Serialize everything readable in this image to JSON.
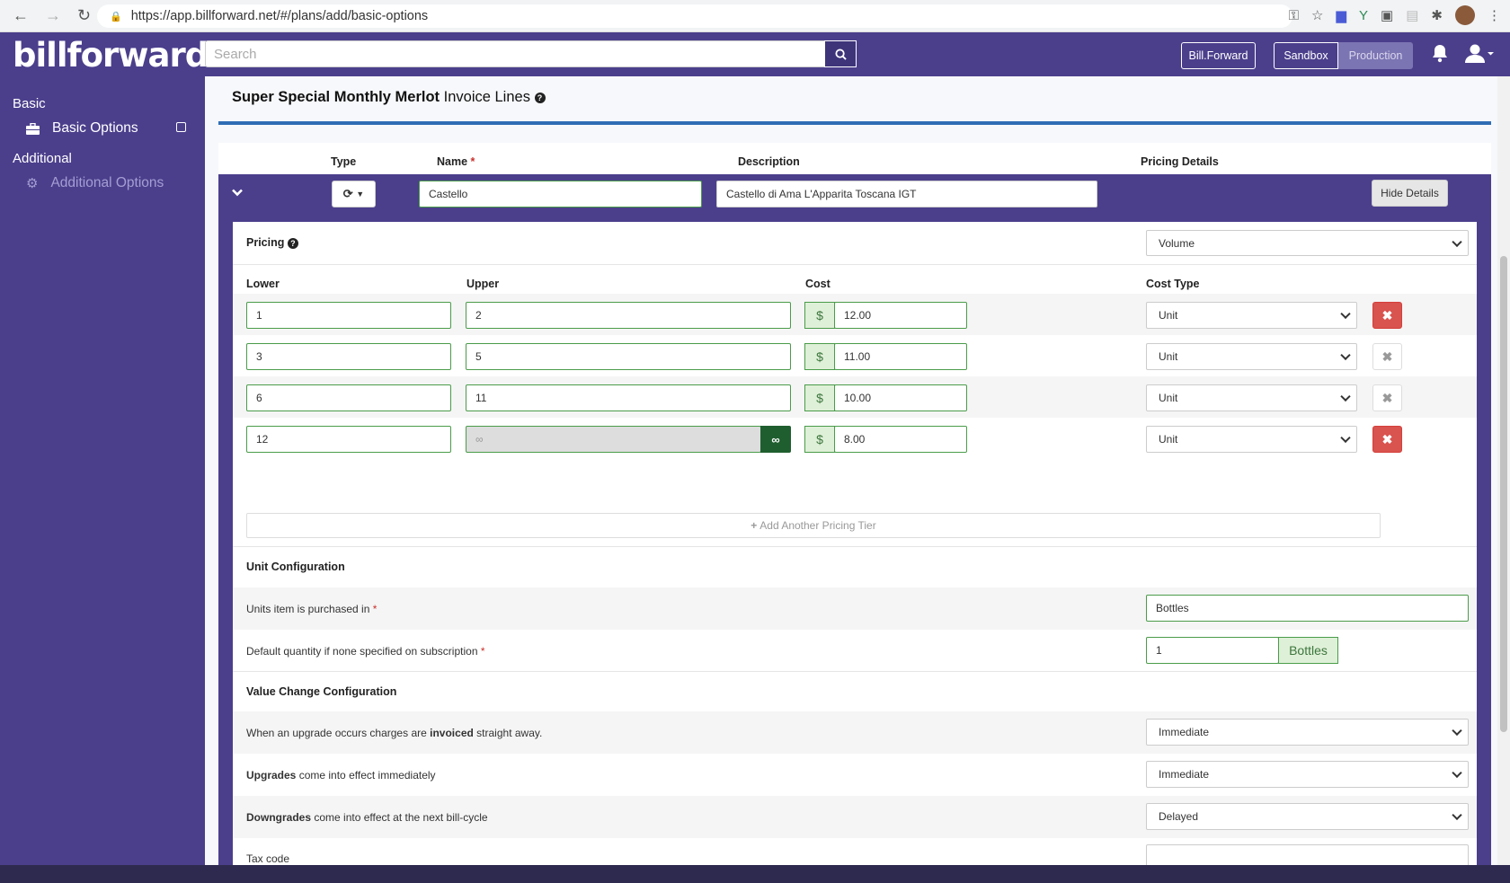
{
  "browser": {
    "url": "https://app.billforward.net/#/plans/add/basic-options"
  },
  "header": {
    "logo": "billforward",
    "search_placeholder": "Search",
    "account_button": "Bill.Forward",
    "sandbox_button": "Sandbox",
    "production_button": "Production"
  },
  "sidebar": {
    "basic_heading": "Basic",
    "basic_options": "Basic Options",
    "additional_heading": "Additional",
    "additional_options": "Additional Options"
  },
  "page": {
    "title_bold": "Super Special Monthly Merlot",
    "title_rest": "Invoice Lines"
  },
  "columns": {
    "type": "Type",
    "name": "Name",
    "description": "Description",
    "pricing_details": "Pricing Details"
  },
  "line": {
    "name": "Castello",
    "description": "Castello di Ama L'Apparita Toscana IGT",
    "hide_details": "Hide Details"
  },
  "pricing": {
    "label": "Pricing",
    "model": "Volume",
    "headers": {
      "lower": "Lower",
      "upper": "Upper",
      "cost": "Cost",
      "cost_type": "Cost Type"
    },
    "currency": "$",
    "tiers": [
      {
        "lower": "1",
        "upper": "2",
        "cost": "12.00",
        "cost_type": "Unit"
      },
      {
        "lower": "3",
        "upper": "5",
        "cost": "11.00",
        "cost_type": "Unit"
      },
      {
        "lower": "6",
        "upper": "11",
        "cost": "10.00",
        "cost_type": "Unit"
      },
      {
        "lower": "12",
        "upper": "∞",
        "cost": "8.00",
        "cost_type": "Unit"
      }
    ],
    "infinity_symbol": "∞",
    "add_tier": "Add Another Pricing Tier"
  },
  "unit_config": {
    "heading": "Unit Configuration",
    "units_label": "Units item is purchased in",
    "units_value": "Bottles",
    "default_qty_label": "Default quantity if none specified on subscription",
    "default_qty_value": "1",
    "default_qty_unit": "Bottles"
  },
  "value_change": {
    "heading": "Value Change Configuration",
    "upgrade_invoice_pre": "When an upgrade occurs charges are",
    "upgrade_invoice_bold": "invoiced",
    "upgrade_invoice_post": "straight away.",
    "upgrade_invoice_value": "Immediate",
    "upgrades_bold": "Upgrades",
    "upgrades_rest": "come into effect immediately",
    "upgrades_value": "Immediate",
    "downgrades_bold": "Downgrades",
    "downgrades_rest": "come into effect at the next bill-cycle",
    "downgrades_value": "Delayed",
    "tax_code_label": "Tax code",
    "tax_code_value": ""
  }
}
